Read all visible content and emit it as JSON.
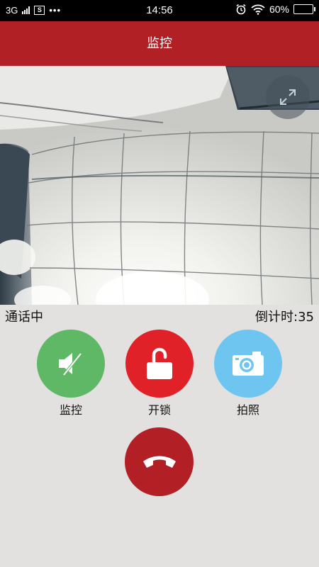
{
  "status_bar": {
    "network": "3G",
    "sim_label": "S",
    "more": "•••",
    "time": "14:56",
    "battery": "60%",
    "battery_level": 0.6
  },
  "header": {
    "title": "监控"
  },
  "video": {
    "fullscreen_icon": "expand-icon"
  },
  "call": {
    "status": "通话中",
    "countdown": "倒计时:35"
  },
  "actions": [
    {
      "label": "监控",
      "icon": "speaker-mute-icon",
      "color": "#5fb866"
    },
    {
      "label": "开锁",
      "icon": "unlock-icon",
      "color": "#e02128"
    },
    {
      "label": "拍照",
      "icon": "camera-icon",
      "color": "#6ec6f0"
    }
  ],
  "hangup": {
    "icon": "hang-up-icon",
    "color": "#b21f24"
  }
}
